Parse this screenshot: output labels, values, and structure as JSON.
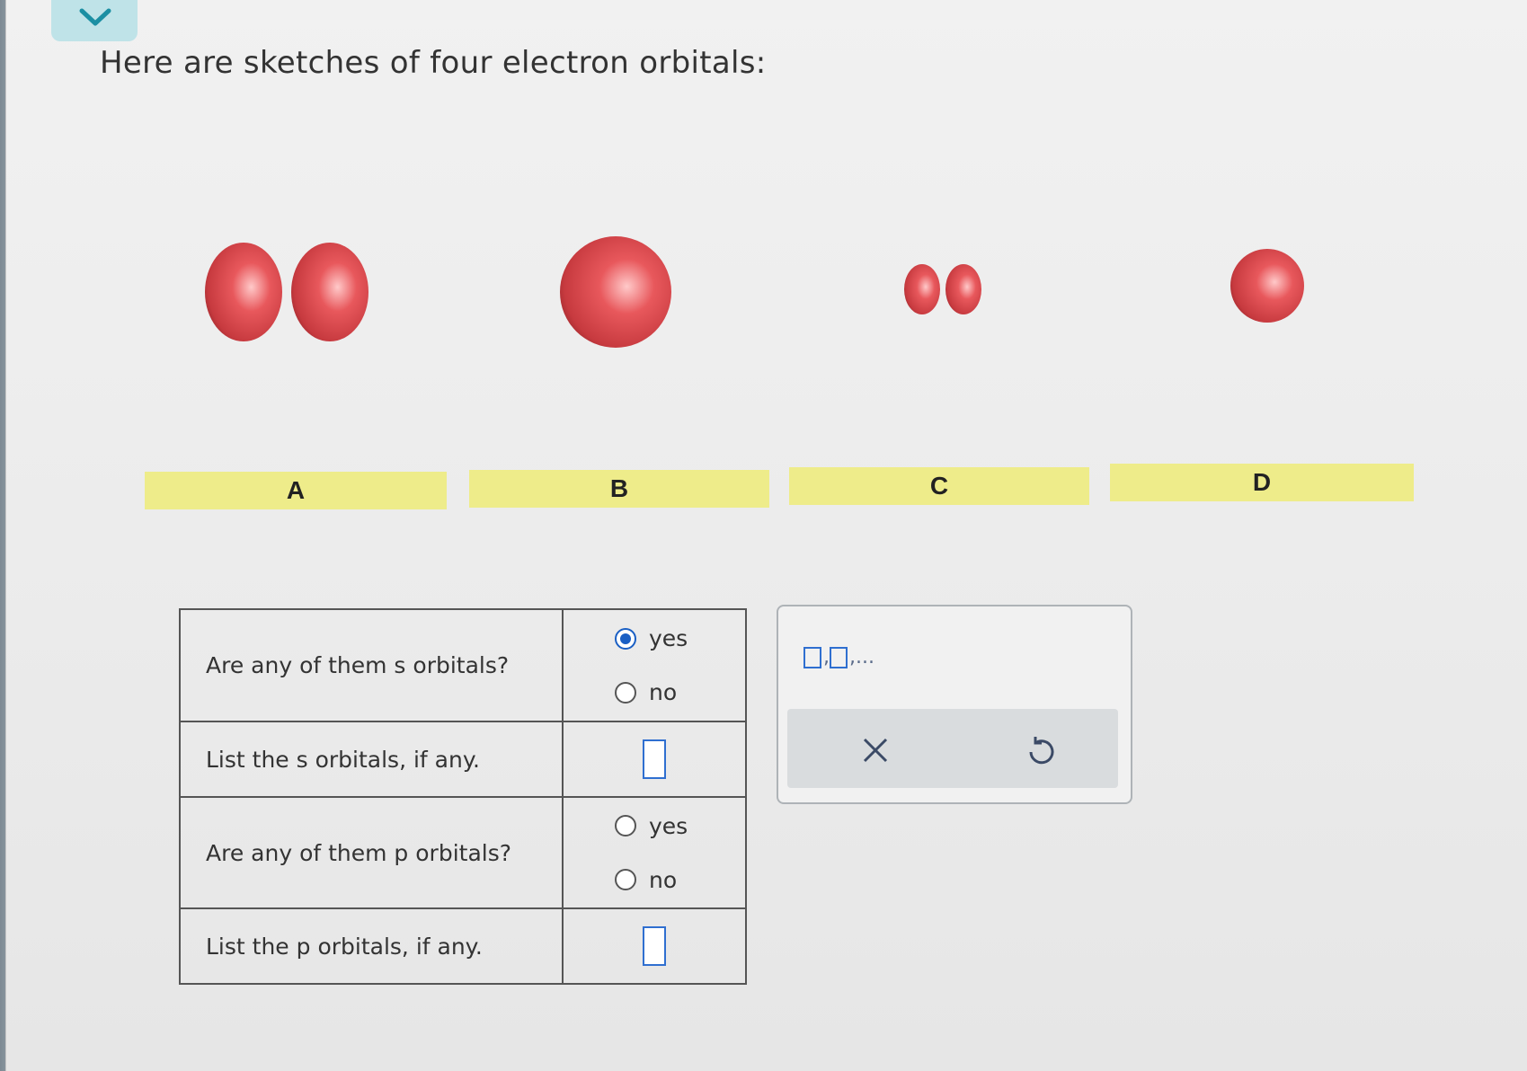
{
  "header": {
    "title": "Here are sketches of four electron orbitals:"
  },
  "orbitals": [
    {
      "label": "A",
      "color": "#d9484c"
    },
    {
      "label": "B",
      "color": "#d9484c"
    },
    {
      "label": "C",
      "color": "#d9484c"
    },
    {
      "label": "D",
      "color": "#d9484c"
    }
  ],
  "questions": {
    "q1": {
      "label": "Are any of them s orbitals?",
      "options": [
        "yes",
        "no"
      ],
      "selected": "yes"
    },
    "q2": {
      "label": "List the s orbitals, if any.",
      "value": ""
    },
    "q3": {
      "label": "Are any of them p orbitals?",
      "options": [
        "yes",
        "no"
      ],
      "selected": ""
    },
    "q4": {
      "label": "List the p orbitals, if any.",
      "value": ""
    }
  },
  "toolbox": {
    "hint_suffix": ",..."
  },
  "colors": {
    "accent": "#1a5fc4",
    "label_bg": "#eeec8a",
    "tab_bg": "#bfe3e8"
  },
  "icons": [
    "chevron-down-icon",
    "clear-x-icon",
    "undo-icon"
  ]
}
